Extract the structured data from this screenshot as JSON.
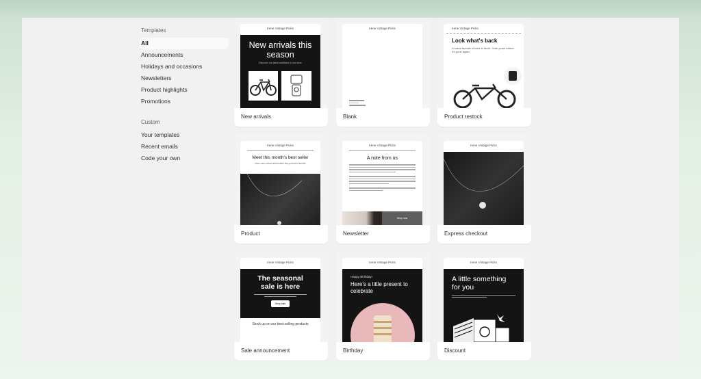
{
  "sidebar": {
    "templates_heading": "Templates",
    "templates": [
      "All",
      "Announcements",
      "Holidays and occasions",
      "Newsletters",
      "Product highlights",
      "Promotions"
    ],
    "custom_heading": "Custom",
    "custom": [
      "Your templates",
      "Recent emails",
      "Code your own"
    ]
  },
  "brand": "Irene Vintage Picks",
  "cards": {
    "new_arrivals": {
      "label": "New arrivals",
      "headline": "New arrivals this season",
      "subline": "Discover our latest additions to our store"
    },
    "blank": {
      "label": "Blank"
    },
    "product_restock": {
      "label": "Product restock",
      "headline": "Look what's back",
      "body": "A brand favorite is back in stock. Grab yours before it's gone again."
    },
    "product": {
      "label": "Product",
      "headline": "Meet this month's best seller",
      "subline": "Learn more about what makes this product a favorite."
    },
    "newsletter": {
      "label": "Newsletter",
      "headline": "A note from us",
      "button": "Shop now"
    },
    "express_checkout": {
      "label": "Express checkout"
    },
    "sale_announcement": {
      "label": "Sale announcement",
      "headline": "The seasonal sale is here",
      "button": "Shop sale",
      "footer": "Stock up on our best-selling products"
    },
    "birthday": {
      "label": "Birthday",
      "greeting": "Happy Birthday!",
      "headline": "Here's a little present to celebrate"
    },
    "discount": {
      "label": "Discount",
      "headline": "A little something for you"
    }
  },
  "colors": {
    "panel": "#f1f1f1",
    "dark": "#141414",
    "birthday_circle": "#e8b8ba"
  }
}
